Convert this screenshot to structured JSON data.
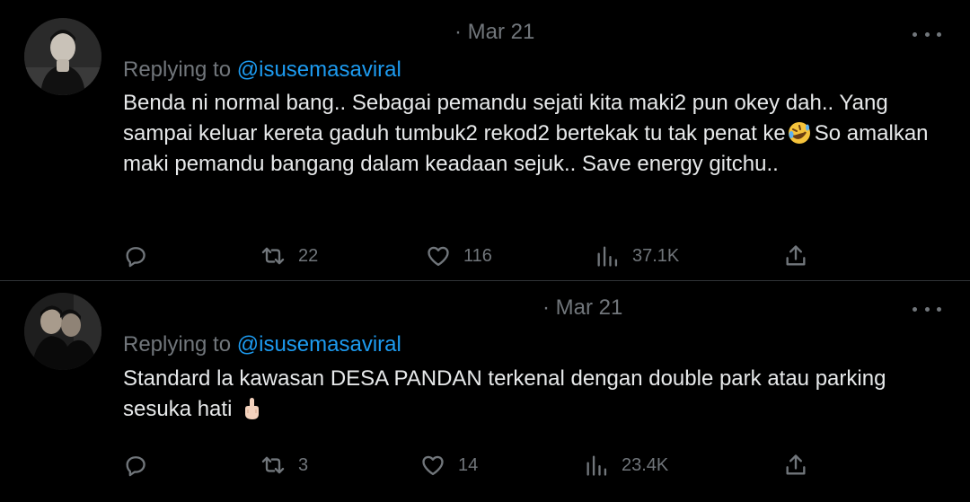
{
  "tweets": [
    {
      "date": "· Mar 21",
      "replying_prefix": "Replying to ",
      "replying_handle": "@isusemasaviral",
      "text_before_emoji": "Benda ni normal bang.. Sebagai pemandu sejati kita maki2 pun okey dah.. Yang sampai keluar kereta gaduh tumbuk2 rekod2 bertekak tu tak penat ke",
      "emoji": "rolling-on-floor-laughing-emoji",
      "text_after_emoji": "So amalkan maki pemandu bangang dalam keadaan sejuk.. Save energy gitchu..",
      "retweets": "22",
      "likes": "116",
      "views": "37.1K"
    },
    {
      "date": "· Mar 21",
      "replying_prefix": "Replying to ",
      "replying_handle": "@isusemasaviral",
      "text_before_emoji": "Standard la kawasan DESA PANDAN terkenal dengan double park atau parking sesuka hati",
      "emoji": "middle-finger-emoji",
      "text_after_emoji": "",
      "retweets": "3",
      "likes": "14",
      "views": "23.4K"
    }
  ],
  "colors": {
    "background": "#000000",
    "text": "#e7e9ea",
    "muted": "#71767b",
    "link": "#1d9bf0",
    "divider": "#2f3336"
  }
}
